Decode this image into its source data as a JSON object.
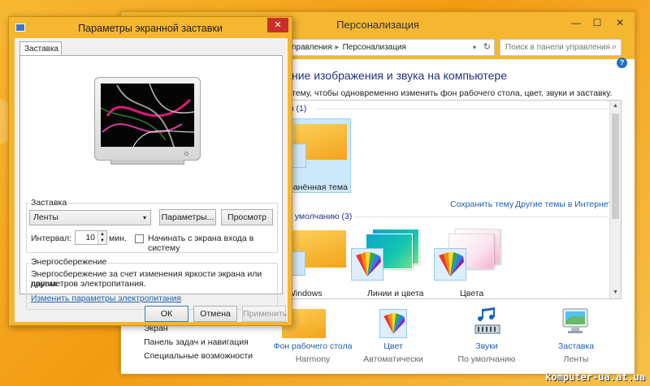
{
  "personalization": {
    "title": "Персонализация",
    "controls": {
      "minimize": "—",
      "maximize": "☐",
      "close": "✕"
    },
    "address": {
      "part1": "управления",
      "sep": "▸",
      "part2": "Персонализация",
      "dropdown": "▾",
      "refresh": "↻"
    },
    "search_placeholder": "Поиск в панели управления",
    "search_icon": "⌕",
    "help": "?",
    "heading": "ние изображения и звука на компьютере",
    "description": "тему, чтобы одновременно изменить фон рабочего стола, цвет, звуки и заставку.",
    "groups": {
      "my_themes": "ы (1)",
      "default_themes": "о умолчанию (3)"
    },
    "my_theme_label": "ранённая тема",
    "links": {
      "save_theme": "Сохранить тему",
      "online_themes": "Другие темы в Интернете"
    },
    "default_themes": [
      {
        "label": "Windows"
      },
      {
        "label": "Линии и цвета"
      },
      {
        "label": "Цвета"
      }
    ],
    "bottom_items": [
      {
        "label": "Фон рабочего стола",
        "sub": "Harmony"
      },
      {
        "label": "Цвет",
        "sub": "Автоматически"
      },
      {
        "label": "Звуки",
        "sub": "По умолчанию"
      },
      {
        "label": "Заставка",
        "sub": "Ленты"
      }
    ],
    "side_links": [
      "Экран",
      "Панель задач и навигация",
      "Специальные возможности"
    ]
  },
  "screensaver_dialog": {
    "title": "Параметры экранной заставки",
    "close": "✕",
    "tab": "Заставка",
    "screensaver_group": "Заставка",
    "selected_screensaver": "Ленты",
    "combo_arrow": "▾",
    "settings_button": "Параметры...",
    "preview_button": "Просмотр",
    "interval_label": "Интервал:",
    "interval_value": "10",
    "spin_up": "▲",
    "spin_down": "▼",
    "interval_unit": "мин.",
    "logon_checkbox_label": "Начинать с экрана входа в систему",
    "logon_checked": false,
    "power_group": "Энергосбережение",
    "power_text_line1": "Энергосбережение за счет изменения яркости экрана или других",
    "power_text_line2": "параметров электропитания.",
    "power_link": "Изменить параметры электропитания",
    "ok": "ОК",
    "cancel": "Отмена",
    "apply": "Применить"
  },
  "watermark": "komputer-ua.at.ua",
  "colors": {
    "titlebar": "#f5b630",
    "link": "#1f5fb4",
    "heading": "#1e3287",
    "close_red": "#c9302c"
  }
}
